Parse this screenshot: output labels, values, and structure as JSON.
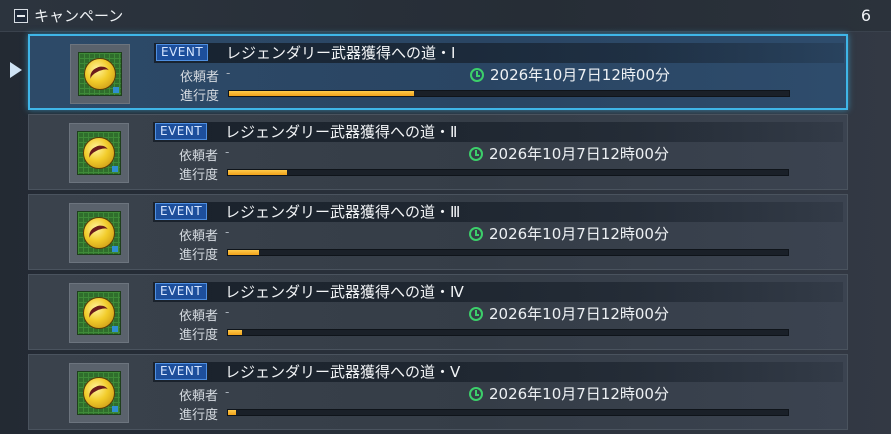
{
  "header": {
    "title": "キャンペーン",
    "count": "6"
  },
  "quests": [
    {
      "badge": "EVENT",
      "title": "レジェンダリー武器獲得への道・Ⅰ",
      "requester_label": "依頼者",
      "requester_value": "-",
      "deadline": "2026年10月7日12時00分",
      "progress_label": "進行度",
      "progress": 0.33,
      "selected": true
    },
    {
      "badge": "EVENT",
      "title": "レジェンダリー武器獲得への道・Ⅱ",
      "requester_label": "依頼者",
      "requester_value": "-",
      "deadline": "2026年10月7日12時00分",
      "progress_label": "進行度",
      "progress": 0.105,
      "selected": false
    },
    {
      "badge": "EVENT",
      "title": "レジェンダリー武器獲得への道・Ⅲ",
      "requester_label": "依頼者",
      "requester_value": "-",
      "deadline": "2026年10月7日12時00分",
      "progress_label": "進行度",
      "progress": 0.055,
      "selected": false
    },
    {
      "badge": "EVENT",
      "title": "レジェンダリー武器獲得への道・Ⅳ",
      "requester_label": "依頼者",
      "requester_value": "-",
      "deadline": "2026年10月7日12時00分",
      "progress_label": "進行度",
      "progress": 0.025,
      "selected": false
    },
    {
      "badge": "EVENT",
      "title": "レジェンダリー武器獲得への道・Ⅴ",
      "requester_label": "依頼者",
      "requester_value": "-",
      "deadline": "2026年10月7日12時00分",
      "progress_label": "進行度",
      "progress": 0.014,
      "selected": false
    }
  ],
  "colors": {
    "selection_border": "#3fb6e8",
    "progress_fill": "#f0a21a",
    "event_badge": "#1d4f9c",
    "clock": "#3ccf6a"
  },
  "icons": {
    "collapse": "minus-box-icon",
    "cursor": "selection-cursor-icon",
    "clock": "clock-icon",
    "quest_thumbnail": "golden-orb-icon"
  }
}
